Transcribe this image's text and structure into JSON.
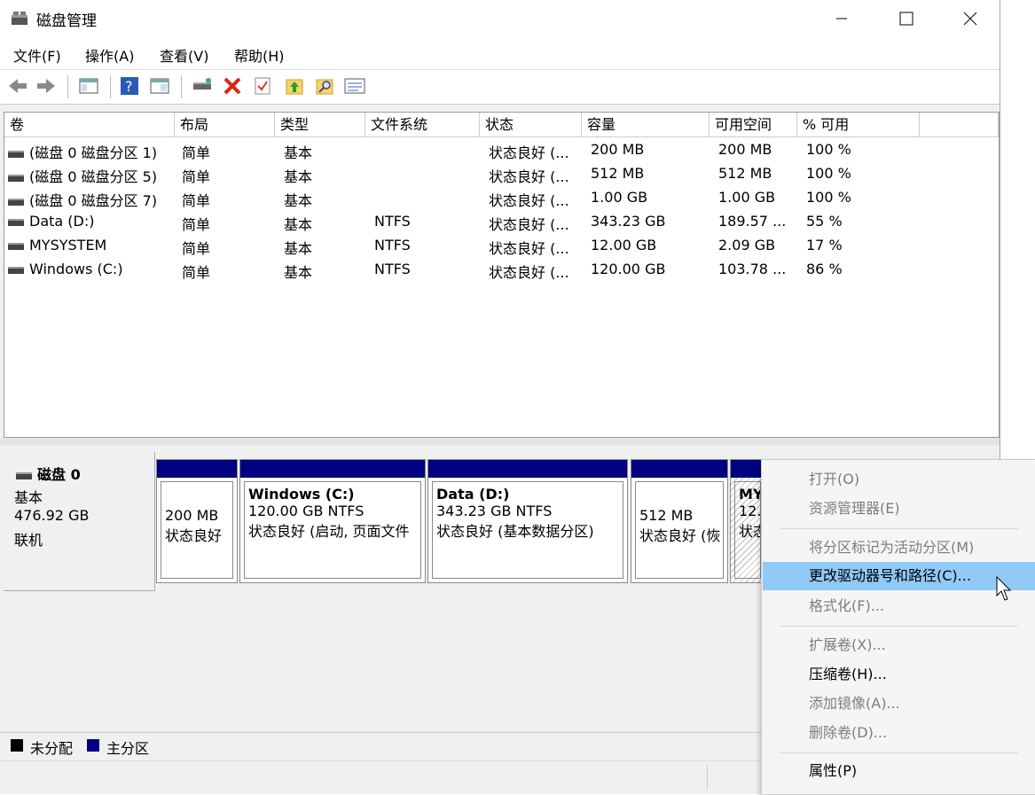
{
  "window": {
    "title": "磁盘管理",
    "minimize": "—",
    "maximize": "☐",
    "close": "✕"
  },
  "menu": [
    "文件(F)",
    "操作(A)",
    "查看(V)",
    "帮助(H)"
  ],
  "toolbar": {
    "icons": [
      "back-icon",
      "forward-icon",
      "console-tree-icon",
      "help-icon",
      "properties-view-icon",
      "connect-disk-icon",
      "delete-icon",
      "check-icon",
      "up-folder-icon",
      "search-folder-icon",
      "list-view-icon"
    ]
  },
  "columns": [
    "卷",
    "布局",
    "类型",
    "文件系统",
    "状态",
    "容量",
    "可用空间",
    "% 可用"
  ],
  "volumes": [
    {
      "name": "(磁盘 0 磁盘分区 1)",
      "layout": "简单",
      "type": "基本",
      "fs": "",
      "status": "状态良好 (...",
      "capacity": "200 MB",
      "free": "200 MB",
      "pct": "100 %"
    },
    {
      "name": "(磁盘 0 磁盘分区 5)",
      "layout": "简单",
      "type": "基本",
      "fs": "",
      "status": "状态良好 (...",
      "capacity": "512 MB",
      "free": "512 MB",
      "pct": "100 %"
    },
    {
      "name": "(磁盘 0 磁盘分区 7)",
      "layout": "简单",
      "type": "基本",
      "fs": "",
      "status": "状态良好 (...",
      "capacity": "1.00 GB",
      "free": "1.00 GB",
      "pct": "100 %"
    },
    {
      "name": "Data (D:)",
      "layout": "简单",
      "type": "基本",
      "fs": "NTFS",
      "status": "状态良好 (...",
      "capacity": "343.23 GB",
      "free": "189.57 ...",
      "pct": "55 %"
    },
    {
      "name": "MYSYSTEM",
      "layout": "简单",
      "type": "基本",
      "fs": "NTFS",
      "status": "状态良好 (...",
      "capacity": "12.00 GB",
      "free": "2.09 GB",
      "pct": "17 %"
    },
    {
      "name": "Windows (C:)",
      "layout": "简单",
      "type": "基本",
      "fs": "NTFS",
      "status": "状态良好 (...",
      "capacity": "120.00 GB",
      "free": "103.78 ...",
      "pct": "86 %"
    }
  ],
  "disk": {
    "name": "磁盘 0",
    "type": "基本",
    "size": "476.92 GB",
    "state": "联机"
  },
  "partitions": [
    {
      "title": "",
      "line1": "200 MB",
      "line2": "状态良好"
    },
    {
      "title": "Windows  (C:)",
      "line1": "120.00 GB NTFS",
      "line2": "状态良好 (启动, 页面文件"
    },
    {
      "title": "Data  (D:)",
      "line1": "343.23 GB NTFS",
      "line2": "状态良好 (基本数据分区)"
    },
    {
      "title": "",
      "line1": "512 MB",
      "line2": "状态良好 (恢"
    },
    {
      "title": "MY",
      "line1": "12.",
      "line2": "状态"
    }
  ],
  "legend": {
    "unallocated": "未分配",
    "primary": "主分区"
  },
  "context_menu": {
    "open": "打开(O)",
    "explore": "资源管理器(E)",
    "mark_active": "将分区标记为活动分区(M)",
    "change_letter": "更改驱动器号和路径(C)...",
    "format": "格式化(F)...",
    "extend": "扩展卷(X)...",
    "shrink": "压缩卷(H)...",
    "mirror": "添加镜像(A)...",
    "delete": "删除卷(D)...",
    "properties": "属性(P)"
  },
  "colors": {
    "primary_partition": "#000080",
    "unallocated": "#000000",
    "highlight": "#91c9f7"
  }
}
